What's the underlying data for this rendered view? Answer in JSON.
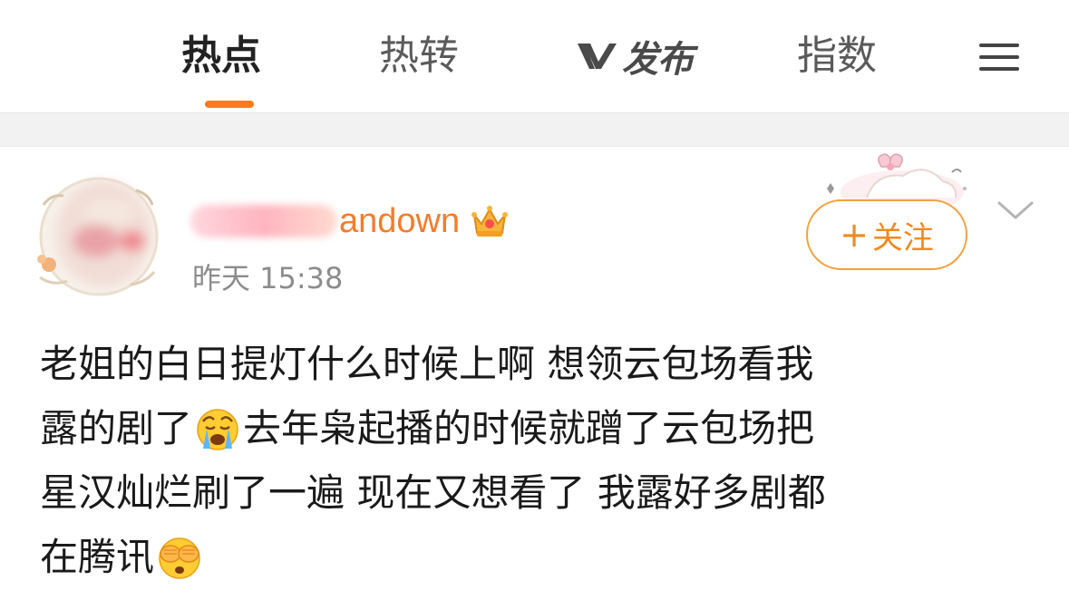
{
  "tabs": [
    {
      "label": "热点",
      "active": true
    },
    {
      "label": "热转",
      "active": false
    },
    {
      "label": "指数",
      "active": false
    }
  ],
  "vpublish": {
    "label": "发布",
    "icon": "v-logo-icon"
  },
  "menu": {
    "icon": "hamburger-menu-icon"
  },
  "accent_color": "#ff7a1f",
  "post": {
    "author": {
      "name_visible_suffix": "andown",
      "badge_icon": "crown-icon"
    },
    "timestamp": "昨天 15:38",
    "follow_button": {
      "plus": "+",
      "label": "关注"
    },
    "more_icon": "chevron-down-icon",
    "body_lines": [
      {
        "before": "老姐的白日提灯什么时候上啊 想领云包场看我",
        "emoji": "",
        "after": ""
      },
      {
        "before": "露的剧了",
        "emoji": "crying-face-icon",
        "after": "去年枭起播的时候就蹭了云包场把"
      },
      {
        "before": "星汉灿烂刷了一遍 现在又想看了 我露好多剧都",
        "emoji": "",
        "after": ""
      },
      {
        "before": "在腾讯",
        "emoji": "face-covering-eyes-icon",
        "after": ""
      }
    ]
  }
}
